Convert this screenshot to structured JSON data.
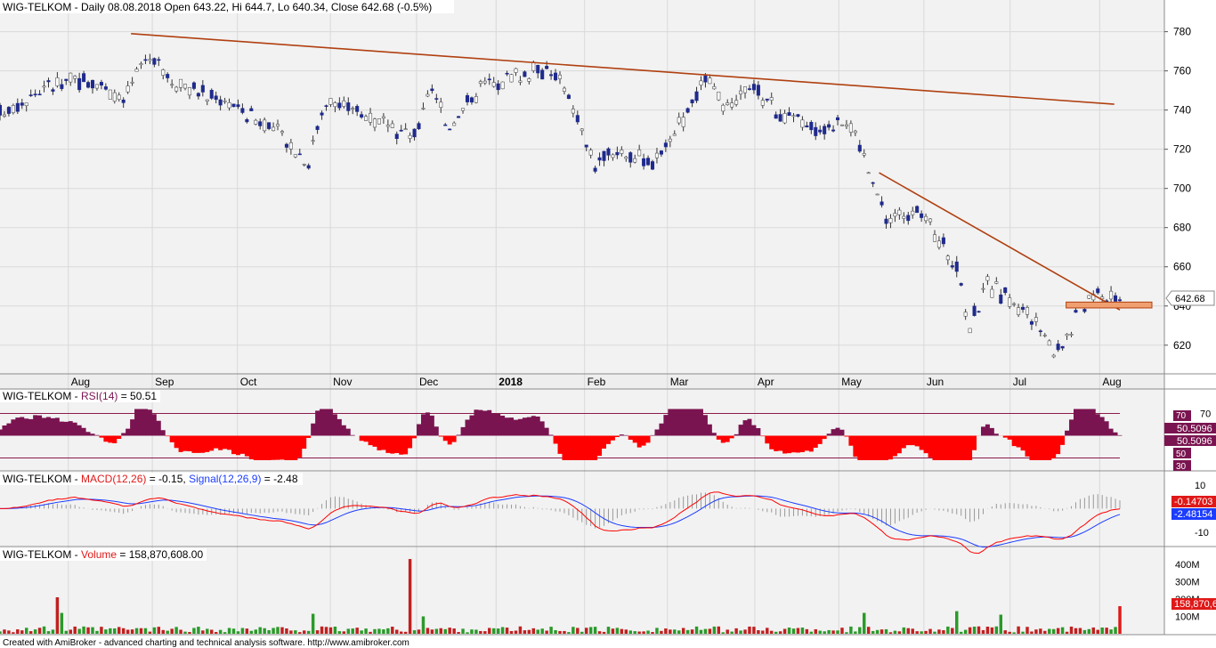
{
  "footer": "Created with AmiBroker - advanced charting and technical analysis software. http://www.amibroker.com",
  "colors": {
    "bg": "#f2f2f2",
    "grid": "#d9d9d9",
    "candle_down": "#1f2a8c",
    "candle_up": "#ffffff",
    "trendline": "#b04010",
    "rsi_fill_up": "#7a1450",
    "rsi_fill_down": "#ff0000",
    "rsi_band": "#8b1a4a",
    "macd": "#ff0000",
    "signal": "#1c3cff",
    "volume": "#2a9a2a",
    "volume_last": "#e01818"
  },
  "chart_data": [
    {
      "pane": "price",
      "type": "candlestick",
      "title_parts": {
        "name": "WIG-TELKOM",
        "rest": " - Daily 08.08.2018 Open 643.22, Hi 644.7, Lo 640.34, Close 642.68 (-0.5%)"
      },
      "open": 643.22,
      "high": 644.7,
      "low": 640.34,
      "close": 642.68,
      "change_pct": -0.5,
      "last_price_label": "642.68",
      "ylim": [
        609,
        788
      ],
      "y_ticks": [
        "780",
        "760",
        "740",
        "720",
        "700",
        "680",
        "660",
        "640",
        "620"
      ],
      "x_months": [
        {
          "label": "Aug",
          "pos": 0.061
        },
        {
          "label": "Sep",
          "pos": 0.136
        },
        {
          "label": "Oct",
          "pos": 0.212
        },
        {
          "label": "Nov",
          "pos": 0.295
        },
        {
          "label": "Dec",
          "pos": 0.372
        },
        {
          "label": "2018",
          "pos": 0.443,
          "bold": true
        },
        {
          "label": "Feb",
          "pos": 0.522
        },
        {
          "label": "Mar",
          "pos": 0.596
        },
        {
          "label": "Apr",
          "pos": 0.674
        },
        {
          "label": "May",
          "pos": 0.749
        },
        {
          "label": "Jun",
          "pos": 0.825
        },
        {
          "label": "Jul",
          "pos": 0.902
        },
        {
          "label": "Aug",
          "pos": 0.982
        }
      ],
      "trend_points": [
        [
          0,
          738
        ],
        [
          0.04,
          752
        ],
        [
          0.08,
          756
        ],
        [
          0.11,
          745
        ],
        [
          0.135,
          770
        ],
        [
          0.15,
          757
        ],
        [
          0.17,
          750
        ],
        [
          0.2,
          746
        ],
        [
          0.23,
          735
        ],
        [
          0.255,
          725
        ],
        [
          0.275,
          714
        ],
        [
          0.29,
          745
        ],
        [
          0.31,
          742
        ],
        [
          0.34,
          733
        ],
        [
          0.37,
          726
        ],
        [
          0.385,
          752
        ],
        [
          0.4,
          732
        ],
        [
          0.43,
          752
        ],
        [
          0.46,
          757
        ],
        [
          0.49,
          762
        ],
        [
          0.51,
          745
        ],
        [
          0.53,
          712
        ],
        [
          0.555,
          720
        ],
        [
          0.58,
          712
        ],
        [
          0.6,
          727
        ],
        [
          0.63,
          755
        ],
        [
          0.65,
          738
        ],
        [
          0.67,
          752
        ],
        [
          0.7,
          737
        ],
        [
          0.73,
          730
        ],
        [
          0.755,
          737
        ],
        [
          0.775,
          712
        ],
        [
          0.79,
          685
        ],
        [
          0.82,
          688
        ],
        [
          0.84,
          673
        ],
        [
          0.855,
          660
        ],
        [
          0.865,
          628
        ],
        [
          0.88,
          651
        ],
        [
          0.9,
          644
        ],
        [
          0.92,
          635
        ],
        [
          0.94,
          617
        ],
        [
          0.955,
          626
        ],
        [
          0.965,
          640
        ],
        [
          0.98,
          648
        ],
        [
          1.0,
          642.68
        ]
      ],
      "trendlines": [
        {
          "x1": 0.117,
          "y1": 779,
          "x2": 0.995,
          "y2": 743
        },
        {
          "x1": 0.785,
          "y1": 708,
          "x2": 1.0,
          "y2": 638
        }
      ],
      "support_box": {
        "x1": 0.952,
        "x2": 1.03,
        "y1": 639,
        "y2": 642
      }
    },
    {
      "pane": "rsi",
      "type": "area",
      "title_parts": {
        "name": "WIG-TELKOM",
        "rest": " - ",
        "ind": "RSI(14)",
        "tail": " = 50.51"
      },
      "value": 50.51,
      "ylim": [
        20,
        80
      ],
      "levels": [
        70,
        30
      ],
      "y_ticks": [
        "70",
        "50",
        "30"
      ],
      "axis_labels": [
        "70",
        "50.5096",
        "50.5096",
        "50",
        "30"
      ]
    },
    {
      "pane": "macd",
      "type": "line",
      "title_parts": {
        "name": "WIG-TELKOM",
        "rest": " - ",
        "ind": "MACD(12,26)",
        "mid": " = -0.15, ",
        "ind2": "Signal(12,26,9)",
        "tail": " = -2.48"
      },
      "macd": -0.15,
      "signal": -2.48,
      "series": [
        {
          "name": "MACD(12,26)"
        },
        {
          "name": "Signal(12,26,9)"
        }
      ],
      "ylim": [
        -15,
        10
      ],
      "y_ticks": [
        "10",
        "-10"
      ],
      "axis_labels": [
        "-0.14703",
        "-2.48154"
      ]
    },
    {
      "pane": "volume",
      "type": "bar",
      "title_parts": {
        "name": "WIG-TELKOM",
        "rest": " - ",
        "ind": "Volume",
        "tail": " = 158,870,608.00"
      },
      "last_volume": 158870608,
      "last_volume_label": "158,870,6",
      "ylim": [
        0,
        420
      ],
      "y_ticks": [
        "400M",
        "300M",
        "200M",
        "100M"
      ],
      "spikes": [
        {
          "pos": 0.052,
          "value": 210
        },
        {
          "pos": 0.056,
          "value": 120
        },
        {
          "pos": 0.278,
          "value": 115
        },
        {
          "pos": 0.367,
          "value": 430
        },
        {
          "pos": 0.378,
          "value": 100
        },
        {
          "pos": 0.77,
          "value": 120
        },
        {
          "pos": 0.853,
          "value": 130
        },
        {
          "pos": 0.893,
          "value": 110
        },
        {
          "pos": 1.0,
          "value": 158.87
        }
      ]
    }
  ]
}
